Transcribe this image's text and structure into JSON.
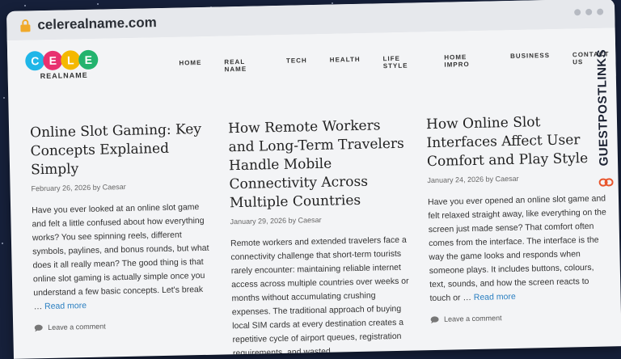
{
  "browser": {
    "url": "celerealname.com"
  },
  "logo": {
    "letters": [
      "C",
      "E",
      "L",
      "E"
    ],
    "letter_colors": [
      "#1fb6e8",
      "#e8316f",
      "#f4b800",
      "#23b36e"
    ],
    "subtitle": "REALNAME"
  },
  "nav": [
    "HOME",
    "REAL NAME",
    "TECH",
    "HEALTH",
    "LIFE STYLE",
    "HOME IMPRO",
    "BUSINESS",
    "CONTACT US"
  ],
  "side_brand": "GUESTPOSTLINKS",
  "posts": [
    {
      "title": "Online Slot Gaming: Key Concepts Explained Simply",
      "date": "February 26, 2026",
      "by": "by",
      "author": "Caesar",
      "excerpt": "Have you ever looked at an online slot game and felt a little confused about how everything works?  You see spinning reels, different symbols, paylines, and bonus rounds, but what does it all really mean? The good thing is that online slot gaming is actually simple once you understand a few basic concepts.  Let's break … ",
      "more": "Read more",
      "comment": "Leave a comment"
    },
    {
      "title": "How Remote Workers and Long-Term Travelers Handle Mobile Connectivity Across Multiple Countries",
      "date": "January 29, 2026",
      "by": "by",
      "author": "Caesar",
      "excerpt": "Remote workers and extended travelers face a connectivity challenge that short-term tourists rarely encounter: maintaining reliable internet access across multiple countries over weeks or months without accumulating crushing expenses. The traditional approach of buying local SIM cards at every destination creates a repetitive cycle of airport queues, registration requirements, and wasted",
      "more": "",
      "comment": ""
    },
    {
      "title": "How Online Slot Interfaces Affect User Comfort and Play Style",
      "date": "January 24, 2026",
      "by": "by",
      "author": "Caesar",
      "excerpt": "Have you ever opened an online slot game and felt relaxed straight away, like everything on the screen just made sense? That comfort often comes from the interface. The interface is the way the game looks and responds when someone plays. It includes buttons, colours, text, sounds, and how the screen reacts to touch or … ",
      "more": "Read more",
      "comment": "Leave a comment"
    }
  ]
}
